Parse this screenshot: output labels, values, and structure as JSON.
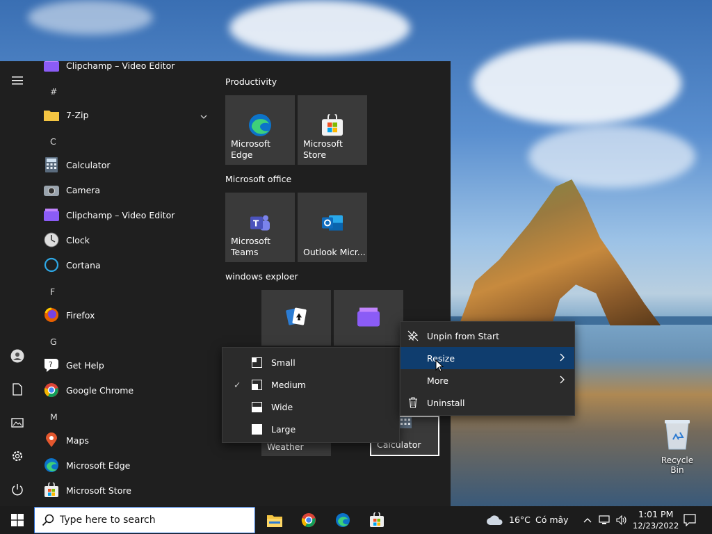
{
  "desktop": {
    "recycle_bin_label": "Recycle Bin"
  },
  "start_menu": {
    "app_list": [
      {
        "type": "app",
        "label": "Clipchamp – Video Editor",
        "icon": "clipchamp-icon"
      },
      {
        "type": "letter",
        "label": "#"
      },
      {
        "type": "app",
        "label": "7-Zip",
        "icon": "folder-icon",
        "expandable": true
      },
      {
        "type": "letter",
        "label": "C"
      },
      {
        "type": "app",
        "label": "Calculator",
        "icon": "calculator-icon"
      },
      {
        "type": "app",
        "label": "Camera",
        "icon": "camera-icon"
      },
      {
        "type": "app",
        "label": "Clipchamp – Video Editor",
        "icon": "clipchamp-icon"
      },
      {
        "type": "app",
        "label": "Clock",
        "icon": "clock-icon"
      },
      {
        "type": "app",
        "label": "Cortana",
        "icon": "cortana-icon"
      },
      {
        "type": "letter",
        "label": "F"
      },
      {
        "type": "app",
        "label": "Firefox",
        "icon": "firefox-icon"
      },
      {
        "type": "letter",
        "label": "G"
      },
      {
        "type": "app",
        "label": "Get Help",
        "icon": "help-icon"
      },
      {
        "type": "app",
        "label": "Google Chrome",
        "icon": "chrome-icon"
      },
      {
        "type": "letter",
        "label": "M"
      },
      {
        "type": "app",
        "label": "Maps",
        "icon": "maps-icon"
      },
      {
        "type": "app",
        "label": "Microsoft Edge",
        "icon": "edge-icon"
      },
      {
        "type": "app",
        "label": "Microsoft Store",
        "icon": "store-icon"
      }
    ],
    "groups": [
      {
        "title": "Productivity",
        "tiles": [
          "Microsoft Edge",
          "Microsoft Store"
        ]
      },
      {
        "title": "Microsoft office",
        "tiles": [
          "Microsoft Teams",
          "Outlook Micr..."
        ]
      },
      {
        "title": "windows  exploer",
        "tiles": [
          "",
          "",
          "Weather",
          "Calculator"
        ]
      }
    ]
  },
  "context_menu": {
    "items": [
      {
        "label": "Unpin from Start",
        "icon": "unpin-icon"
      },
      {
        "label": "Resize",
        "submenu": true,
        "highlighted": true
      },
      {
        "label": "More",
        "submenu": true
      },
      {
        "label": "Uninstall",
        "icon": "trash-icon"
      }
    ]
  },
  "resize_submenu": {
    "options": [
      {
        "label": "Small",
        "checked": false
      },
      {
        "label": "Medium",
        "checked": true
      },
      {
        "label": "Wide",
        "checked": false
      },
      {
        "label": "Large",
        "checked": false
      }
    ]
  },
  "taskbar": {
    "search_placeholder": "Type here to search",
    "weather_temp": "16°C",
    "weather_desc": "Có mây",
    "time": "1:01 PM",
    "date": "12/23/2022"
  },
  "colors": {
    "accent": "#0f3d6e",
    "menu_bg": "#2b2b2b",
    "start_bg": "#1f1f1f",
    "tile_bg": "#3a3a3a"
  }
}
